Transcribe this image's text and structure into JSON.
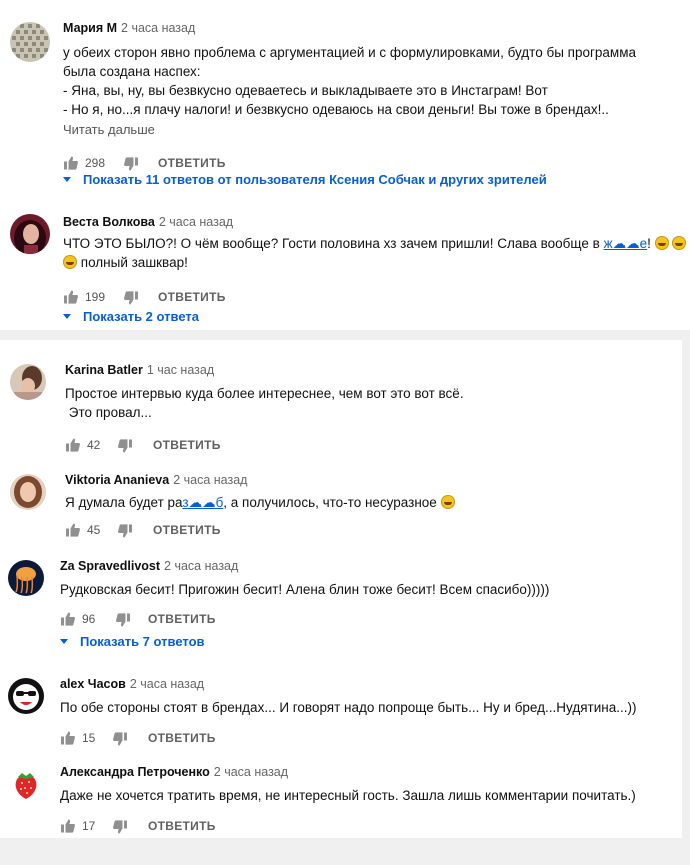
{
  "reply_label": "ОТВЕТИТЬ",
  "comments": [
    {
      "author": "Мария М",
      "time": "2 часа назад",
      "lines": [
        "у обеих сторон явно проблема с аргументацией и с формулировками, будто бы программа",
        "была создана наспех:",
        "- Яна, вы, ну, вы безвкусно одеваетесь и выкладываете это в Инстаграм! Вот",
        "- Но я, но...я плачу налоги! и безвкусно одеваюсь на свои деньги! Вы тоже в брендах!.."
      ],
      "read_more": "Читать дальше",
      "likes": "298",
      "replies_label": "Показать 11 ответов от пользователя Ксения Собчак и других зрителей",
      "avatar_icon": "pattern-avatar-icon"
    },
    {
      "author": "Веста Волкова",
      "time": "2 часа назад",
      "line1_a": "ЧТО ЭТО БЫЛО?! О чём вообще? Гости половина хз зачем пришли! Слава вообще в ",
      "line1_link": "ж☁☁е",
      "line1_b": "! ",
      "line2": "полный зашквар!",
      "likes": "199",
      "replies_label": "Показать 2 ответа",
      "avatar_icon": "woman-avatar-icon"
    },
    {
      "author": "Karina Batler",
      "time": "1 час назад",
      "lines": [
        "Простое интервью куда более интереснее, чем вот это вот всё.",
        " Это провал..."
      ],
      "likes": "42",
      "avatar_icon": "woman-avatar-icon"
    },
    {
      "author": "Viktoria Ananieva",
      "time": "2 часа назад",
      "text_a": "Я думала будет ра",
      "text_link": "з☁☁б",
      "text_b": ", а получилось, что-то несуразное ",
      "likes": "45",
      "avatar_icon": "woman-avatar-icon"
    },
    {
      "author": "Za Spravedlivost",
      "time": "2 часа назад",
      "lines": [
        "Рудковская бесит! Пригожин бесит! Алена блин тоже бесит! Всем спасибо)))))"
      ],
      "likes": "96",
      "replies_label": "Показать 7 ответов",
      "avatar_icon": "jellyfish-avatar-icon"
    },
    {
      "author": "alex Часов",
      "time": "2 часа назад",
      "lines": [
        "По обе стороны стоят в брендах... И говорят надо попроще быть... Ну и бред...Нудятина...))"
      ],
      "likes": "15",
      "avatar_icon": "sunglasses-avatar-icon"
    },
    {
      "author": "Александра Петроченко",
      "time": "2 часа назад",
      "lines": [
        "Даже не хочется тратить время, не интересный гость. Зашла лишь комментарии почитать.)"
      ],
      "likes": "17",
      "avatar_icon": "strawberry-avatar-icon"
    }
  ]
}
